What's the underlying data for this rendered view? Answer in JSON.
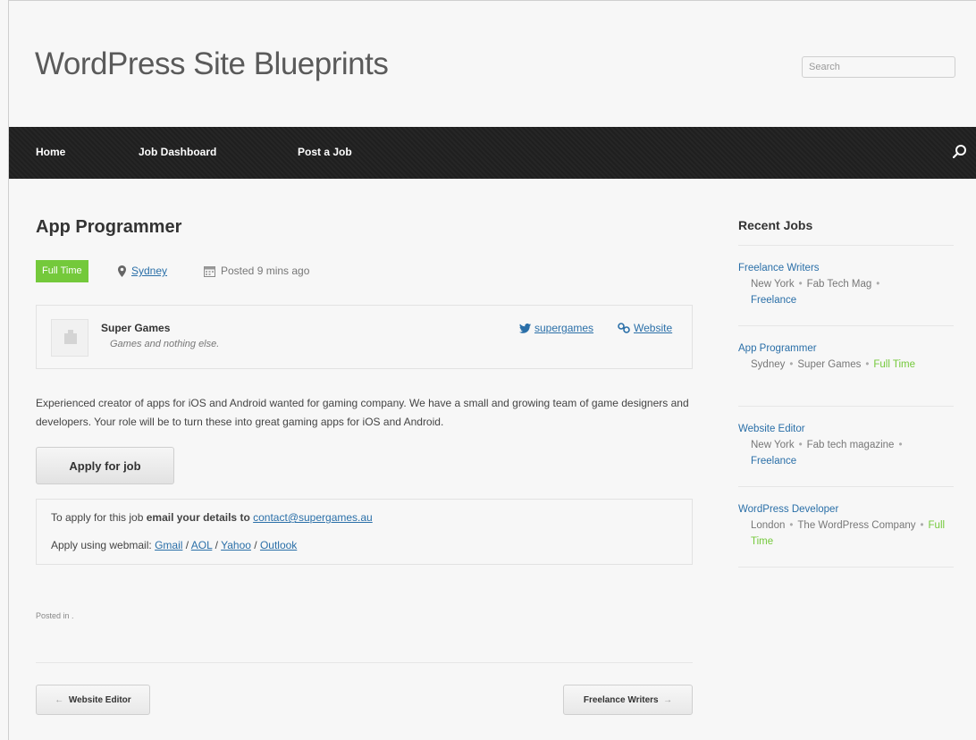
{
  "site": {
    "title": "WordPress Site Blueprints",
    "search_placeholder": "Search"
  },
  "nav": {
    "items": [
      "Home",
      "Job Dashboard",
      "Post a Job"
    ]
  },
  "job": {
    "title": "App Programmer",
    "type": "Full Time",
    "location": "Sydney",
    "posted": "Posted 9 mins ago",
    "company": {
      "name": "Super Games",
      "tagline": "Games and nothing else.",
      "twitter": "supergames",
      "website": "Website"
    },
    "description": "Experienced creator of apps for iOS and Android wanted for gaming company. We have a small and growing team of game designers and developers. Your role will be to turn these into great gaming apps for iOS and Android.",
    "apply_button": "Apply for job",
    "apply": {
      "line1_prefix": "To apply for this job ",
      "line1_bold": "email your details to",
      "email": "contact@supergames.au",
      "line2_prefix": "Apply using webmail: ",
      "webmail": [
        "Gmail",
        "AOL",
        "Yahoo",
        "Outlook"
      ],
      "separator": " / "
    },
    "posted_in": "Posted in .",
    "prev": "Website Editor",
    "next": "Freelance Writers"
  },
  "sidebar": {
    "title": "Recent Jobs",
    "items": [
      {
        "title": "Freelance Writers",
        "location": "New York",
        "company": "Fab Tech Mag",
        "type": "Freelance",
        "type_color": "blue"
      },
      {
        "title": "App Programmer",
        "location": "Sydney",
        "company": "Super Games",
        "type": "Full Time",
        "type_color": "green"
      },
      {
        "title": "Website Editor",
        "location": "New York",
        "company": "Fab tech magazine",
        "type": "Freelance",
        "type_color": "blue"
      },
      {
        "title": "WordPress Developer",
        "location": "London",
        "company": "The WordPress Company",
        "type": "Full Time",
        "type_color": "green"
      }
    ],
    "separator": "•"
  },
  "colors": {
    "accent": "#2a6fa8",
    "full_time": "#74c93b",
    "navbar": "#232323"
  }
}
